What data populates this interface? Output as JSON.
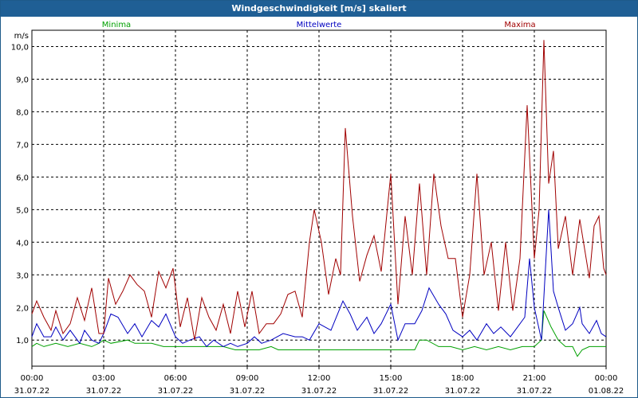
{
  "chart_data": {
    "type": "line",
    "title": "Windgeschwindigkeit [m/s] skaliert",
    "ylabel": "m/s",
    "ylim": [
      0.2,
      10.5
    ],
    "y_ticks": [
      "1,0",
      "2,0",
      "3,0",
      "4,0",
      "5,0",
      "6,0",
      "7,0",
      "8,0",
      "9,0",
      "10,0"
    ],
    "y_tick_values": [
      1,
      2,
      3,
      4,
      5,
      6,
      7,
      8,
      9,
      10
    ],
    "x_unit": "hours",
    "xlim": [
      0,
      24
    ],
    "x_ticks": [
      {
        "time": "00:00",
        "date": "31.07.22"
      },
      {
        "time": "03:00",
        "date": "31.07.22"
      },
      {
        "time": "06:00",
        "date": "31.07.22"
      },
      {
        "time": "09:00",
        "date": "31.07.22"
      },
      {
        "time": "12:00",
        "date": "31.07.22"
      },
      {
        "time": "15:00",
        "date": "31.07.22"
      },
      {
        "time": "18:00",
        "date": "31.07.22"
      },
      {
        "time": "21:00",
        "date": "31.07.22"
      },
      {
        "time": "00:00",
        "date": "01.08.22"
      }
    ],
    "x_tick_values": [
      0,
      3,
      6,
      9,
      12,
      15,
      18,
      21,
      24
    ],
    "grid": true,
    "series": [
      {
        "name": "Minima",
        "color": "#00a000",
        "points": [
          [
            0,
            0.8
          ],
          [
            0.2,
            0.9
          ],
          [
            0.5,
            0.8
          ],
          [
            1,
            0.9
          ],
          [
            1.5,
            0.8
          ],
          [
            2,
            0.9
          ],
          [
            2.5,
            0.8
          ],
          [
            2.8,
            0.9
          ],
          [
            3,
            1.0
          ],
          [
            3.3,
            0.9
          ],
          [
            4,
            1.0
          ],
          [
            4.3,
            0.9
          ],
          [
            5,
            0.9
          ],
          [
            5.5,
            0.8
          ],
          [
            6,
            0.8
          ],
          [
            6.5,
            0.8
          ],
          [
            7,
            0.8
          ],
          [
            7.5,
            0.8
          ],
          [
            8,
            0.8
          ],
          [
            8.5,
            0.7
          ],
          [
            9,
            0.7
          ],
          [
            9.5,
            0.7
          ],
          [
            10,
            0.8
          ],
          [
            10.3,
            0.7
          ],
          [
            11,
            0.7
          ],
          [
            12,
            0.7
          ],
          [
            13,
            0.7
          ],
          [
            14,
            0.7
          ],
          [
            15,
            0.7
          ],
          [
            16,
            0.7
          ],
          [
            16.2,
            1.0
          ],
          [
            16.5,
            1.0
          ],
          [
            17,
            0.8
          ],
          [
            17.5,
            0.8
          ],
          [
            18,
            0.7
          ],
          [
            18.5,
            0.8
          ],
          [
            19,
            0.7
          ],
          [
            19.5,
            0.8
          ],
          [
            20,
            0.7
          ],
          [
            20.5,
            0.8
          ],
          [
            21,
            0.8
          ],
          [
            21.3,
            1.0
          ],
          [
            21.4,
            1.9
          ],
          [
            21.7,
            1.4
          ],
          [
            22,
            1.0
          ],
          [
            22.3,
            0.8
          ],
          [
            22.6,
            0.8
          ],
          [
            22.8,
            0.5
          ],
          [
            23,
            0.7
          ],
          [
            23.3,
            0.8
          ],
          [
            23.5,
            0.8
          ],
          [
            24,
            0.8
          ]
        ]
      },
      {
        "name": "Mittelwerte",
        "color": "#0000c0",
        "points": [
          [
            0,
            1.1
          ],
          [
            0.2,
            1.5
          ],
          [
            0.5,
            1.1
          ],
          [
            0.8,
            1.1
          ],
          [
            1,
            1.4
          ],
          [
            1.3,
            1.0
          ],
          [
            1.6,
            1.3
          ],
          [
            2,
            0.9
          ],
          [
            2.2,
            1.3
          ],
          [
            2.5,
            1.0
          ],
          [
            2.8,
            0.9
          ],
          [
            3,
            1.2
          ],
          [
            3.3,
            1.8
          ],
          [
            3.6,
            1.7
          ],
          [
            4,
            1.2
          ],
          [
            4.3,
            1.5
          ],
          [
            4.6,
            1.1
          ],
          [
            5,
            1.6
          ],
          [
            5.3,
            1.4
          ],
          [
            5.6,
            1.8
          ],
          [
            6,
            1.1
          ],
          [
            6.3,
            0.9
          ],
          [
            6.6,
            1.0
          ],
          [
            7,
            1.1
          ],
          [
            7.3,
            0.8
          ],
          [
            7.6,
            1.0
          ],
          [
            8,
            0.8
          ],
          [
            8.3,
            0.9
          ],
          [
            8.6,
            0.8
          ],
          [
            9,
            0.9
          ],
          [
            9.3,
            1.1
          ],
          [
            9.6,
            0.9
          ],
          [
            10,
            1.0
          ],
          [
            10.5,
            1.2
          ],
          [
            11,
            1.1
          ],
          [
            11.3,
            1.1
          ],
          [
            11.6,
            1.0
          ],
          [
            12,
            1.5
          ],
          [
            12.5,
            1.3
          ],
          [
            13,
            2.2
          ],
          [
            13.3,
            1.8
          ],
          [
            13.6,
            1.3
          ],
          [
            14,
            1.7
          ],
          [
            14.3,
            1.2
          ],
          [
            14.6,
            1.5
          ],
          [
            15,
            2.1
          ],
          [
            15.3,
            1.0
          ],
          [
            15.6,
            1.5
          ],
          [
            16,
            1.5
          ],
          [
            16.3,
            1.9
          ],
          [
            16.6,
            2.6
          ],
          [
            17,
            2.1
          ],
          [
            17.3,
            1.8
          ],
          [
            17.6,
            1.3
          ],
          [
            18,
            1.1
          ],
          [
            18.3,
            1.3
          ],
          [
            18.6,
            1.0
          ],
          [
            19,
            1.5
          ],
          [
            19.3,
            1.2
          ],
          [
            19.6,
            1.4
          ],
          [
            20,
            1.1
          ],
          [
            20.3,
            1.4
          ],
          [
            20.6,
            1.7
          ],
          [
            20.8,
            3.5
          ],
          [
            21,
            2.0
          ],
          [
            21.3,
            1.0
          ],
          [
            21.6,
            5.0
          ],
          [
            21.8,
            2.5
          ],
          [
            22,
            2.0
          ],
          [
            22.3,
            1.3
          ],
          [
            22.6,
            1.5
          ],
          [
            22.9,
            2.0
          ],
          [
            23,
            1.5
          ],
          [
            23.3,
            1.2
          ],
          [
            23.6,
            1.6
          ],
          [
            23.8,
            1.2
          ],
          [
            24,
            1.1
          ]
        ]
      },
      {
        "name": "Maxima",
        "color": "#a00000",
        "points": [
          [
            0,
            1.8
          ],
          [
            0.2,
            2.2
          ],
          [
            0.5,
            1.7
          ],
          [
            0.8,
            1.3
          ],
          [
            1,
            1.9
          ],
          [
            1.3,
            1.2
          ],
          [
            1.6,
            1.5
          ],
          [
            1.9,
            2.3
          ],
          [
            2.2,
            1.6
          ],
          [
            2.5,
            2.6
          ],
          [
            2.8,
            1.2
          ],
          [
            3,
            1.2
          ],
          [
            3.2,
            2.9
          ],
          [
            3.5,
            2.1
          ],
          [
            3.8,
            2.5
          ],
          [
            4.1,
            3.0
          ],
          [
            4.4,
            2.7
          ],
          [
            4.7,
            2.5
          ],
          [
            5,
            1.7
          ],
          [
            5.3,
            3.1
          ],
          [
            5.6,
            2.6
          ],
          [
            5.9,
            3.2
          ],
          [
            6.2,
            1.4
          ],
          [
            6.5,
            2.3
          ],
          [
            6.8,
            1.0
          ],
          [
            7.1,
            2.3
          ],
          [
            7.4,
            1.7
          ],
          [
            7.7,
            1.3
          ],
          [
            8,
            2.1
          ],
          [
            8.3,
            1.2
          ],
          [
            8.6,
            2.5
          ],
          [
            8.9,
            1.4
          ],
          [
            9.2,
            2.5
          ],
          [
            9.5,
            1.2
          ],
          [
            9.8,
            1.5
          ],
          [
            10.1,
            1.5
          ],
          [
            10.4,
            1.8
          ],
          [
            10.7,
            2.4
          ],
          [
            11,
            2.5
          ],
          [
            11.3,
            1.7
          ],
          [
            11.6,
            4.0
          ],
          [
            11.8,
            5.0
          ],
          [
            12.1,
            4.0
          ],
          [
            12.4,
            2.4
          ],
          [
            12.7,
            3.5
          ],
          [
            12.9,
            3.0
          ],
          [
            13.1,
            7.5
          ],
          [
            13.4,
            4.8
          ],
          [
            13.7,
            2.8
          ],
          [
            14,
            3.6
          ],
          [
            14.3,
            4.2
          ],
          [
            14.6,
            3.1
          ],
          [
            15,
            6.1
          ],
          [
            15.3,
            2.1
          ],
          [
            15.6,
            4.8
          ],
          [
            15.9,
            3.0
          ],
          [
            16.2,
            5.8
          ],
          [
            16.5,
            3.0
          ],
          [
            16.8,
            6.1
          ],
          [
            17.1,
            4.5
          ],
          [
            17.4,
            3.5
          ],
          [
            17.7,
            3.5
          ],
          [
            18,
            1.7
          ],
          [
            18.3,
            3.0
          ],
          [
            18.6,
            6.1
          ],
          [
            18.9,
            3.0
          ],
          [
            19.2,
            4.0
          ],
          [
            19.5,
            1.9
          ],
          [
            19.8,
            4.0
          ],
          [
            20.1,
            1.9
          ],
          [
            20.4,
            3.5
          ],
          [
            20.7,
            8.2
          ],
          [
            21,
            3.5
          ],
          [
            21.2,
            5.0
          ],
          [
            21.4,
            10.2
          ],
          [
            21.6,
            5.8
          ],
          [
            21.8,
            6.8
          ],
          [
            22,
            3.8
          ],
          [
            22.3,
            4.8
          ],
          [
            22.6,
            3.0
          ],
          [
            22.9,
            4.7
          ],
          [
            23.1,
            3.8
          ],
          [
            23.3,
            2.9
          ],
          [
            23.5,
            4.5
          ],
          [
            23.7,
            4.8
          ],
          [
            23.9,
            3.2
          ],
          [
            24,
            3.0
          ]
        ]
      }
    ]
  }
}
